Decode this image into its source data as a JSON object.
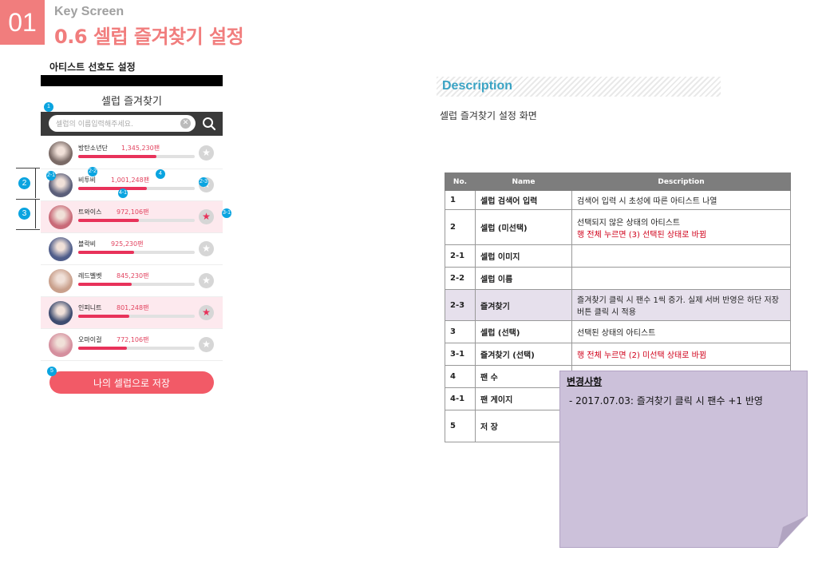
{
  "header": {
    "number": "01",
    "subtitle": "Key Screen",
    "title": "0.6 셀럽 즐겨찾기 설정"
  },
  "screen_label": "아티스트 선호도 설정",
  "phone": {
    "title": "셀럽 즐겨찾기",
    "search_placeholder": "셀럽의 이름입력해주세요.",
    "save_label": "나의 셀럽으로 저장",
    "rows": [
      {
        "name": "방탄소년단",
        "fans": "1,345,230팬",
        "gauge": 0.67,
        "selected": false,
        "avatar_color": "#7a6a66"
      },
      {
        "name": "비투비",
        "fans": "1,001,248팬",
        "gauge": 0.59,
        "selected": false,
        "avatar_color": "#5b5f7a"
      },
      {
        "name": "트와이스",
        "fans": "972,106팬",
        "gauge": 0.52,
        "selected": true,
        "avatar_color": "#c96a78"
      },
      {
        "name": "블락비",
        "fans": "925,230팬",
        "gauge": 0.48,
        "selected": false,
        "avatar_color": "#4f5d8a"
      },
      {
        "name": "레드벨벳",
        "fans": "845,230팬",
        "gauge": 0.46,
        "selected": false,
        "avatar_color": "#c9a08c"
      },
      {
        "name": "인피니트",
        "fans": "801,248팬",
        "gauge": 0.44,
        "selected": true,
        "avatar_color": "#3e4c70"
      },
      {
        "name": "오마이걸",
        "fans": "772,106팬",
        "gauge": 0.42,
        "selected": false,
        "avatar_color": "#d58f9e"
      }
    ]
  },
  "markers": {
    "m1": "1",
    "m2": "2",
    "m3": "3",
    "m4": "4",
    "m5": "5",
    "m21": "2-1",
    "m22": "2-2",
    "m23": "2-3",
    "m31": "3-1",
    "m41": "4-1"
  },
  "description": {
    "heading": "Description",
    "text": "셀럽 즐겨찾기 설정 화면",
    "columns": [
      "No.",
      "Name",
      "Description"
    ],
    "rows": [
      {
        "no": "1",
        "name": "셀럽 검색어 입력",
        "desc": "검색어 입력 시 초성에 따른 아티스트 나열",
        "desc2": ""
      },
      {
        "no": "2",
        "name": "셀럽 (미선택)",
        "desc": "선택되지 않은 상태의 아티스트",
        "desc2": "행 전체 누르면 (3) 선택된 상태로 바뀜"
      },
      {
        "no": "2-1",
        "name": "셀럽 이미지",
        "desc": "",
        "desc2": ""
      },
      {
        "no": "2-2",
        "name": "셀럽 이름",
        "desc": "",
        "desc2": ""
      },
      {
        "no": "2-3",
        "name": "즐겨찾기",
        "desc": "즐겨찾기 클릭 시 팬수 1씩 증가. 실제 서버 반영은 하단 저장 버튼 클릭 시 적용",
        "desc2": ""
      },
      {
        "no": "3",
        "name": "셀럽 (선택)",
        "desc": "선택된 상태의 아티스트",
        "desc2": ""
      },
      {
        "no": "3-1",
        "name": "즐겨찾기 (선택)",
        "desc": "",
        "desc2": "행 전체 누르면 (2) 미선택 상태로 바뀜"
      },
      {
        "no": "4",
        "name": "팬 수",
        "desc": "",
        "desc2": ""
      },
      {
        "no": "4-1",
        "name": "팬 게이지",
        "desc": "",
        "desc2": ""
      },
      {
        "no": "5",
        "name": "저 장",
        "desc": "",
        "desc2": ""
      }
    ]
  },
  "note": {
    "title": "변경사항",
    "item": "-     2017.07.03:  즐겨찾기 클릭 시 팬수 +1 반영"
  },
  "colors": {
    "brand": "#f17d7d",
    "accent": "#e8325a",
    "marker": "#0aa4e0",
    "note": "#ccc1da"
  }
}
